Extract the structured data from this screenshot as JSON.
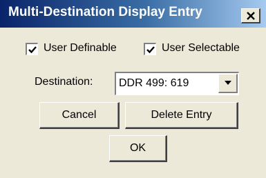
{
  "window": {
    "title": "Multi-Destination Display Entry",
    "close_icon": "close-icon"
  },
  "options": {
    "user_definable_label": "User Definable",
    "user_definable_checked": true,
    "user_selectable_label": "User Selectable",
    "user_selectable_checked": true
  },
  "destination": {
    "label": "Destination:",
    "value": "DDR 499: 619"
  },
  "buttons": {
    "cancel_label": "Cancel",
    "delete_label": "Delete Entry",
    "ok_label": "OK"
  },
  "colors": {
    "titlebar_start": "#0a246a",
    "titlebar_end": "#a6caf0",
    "face": "#ece9d8"
  }
}
